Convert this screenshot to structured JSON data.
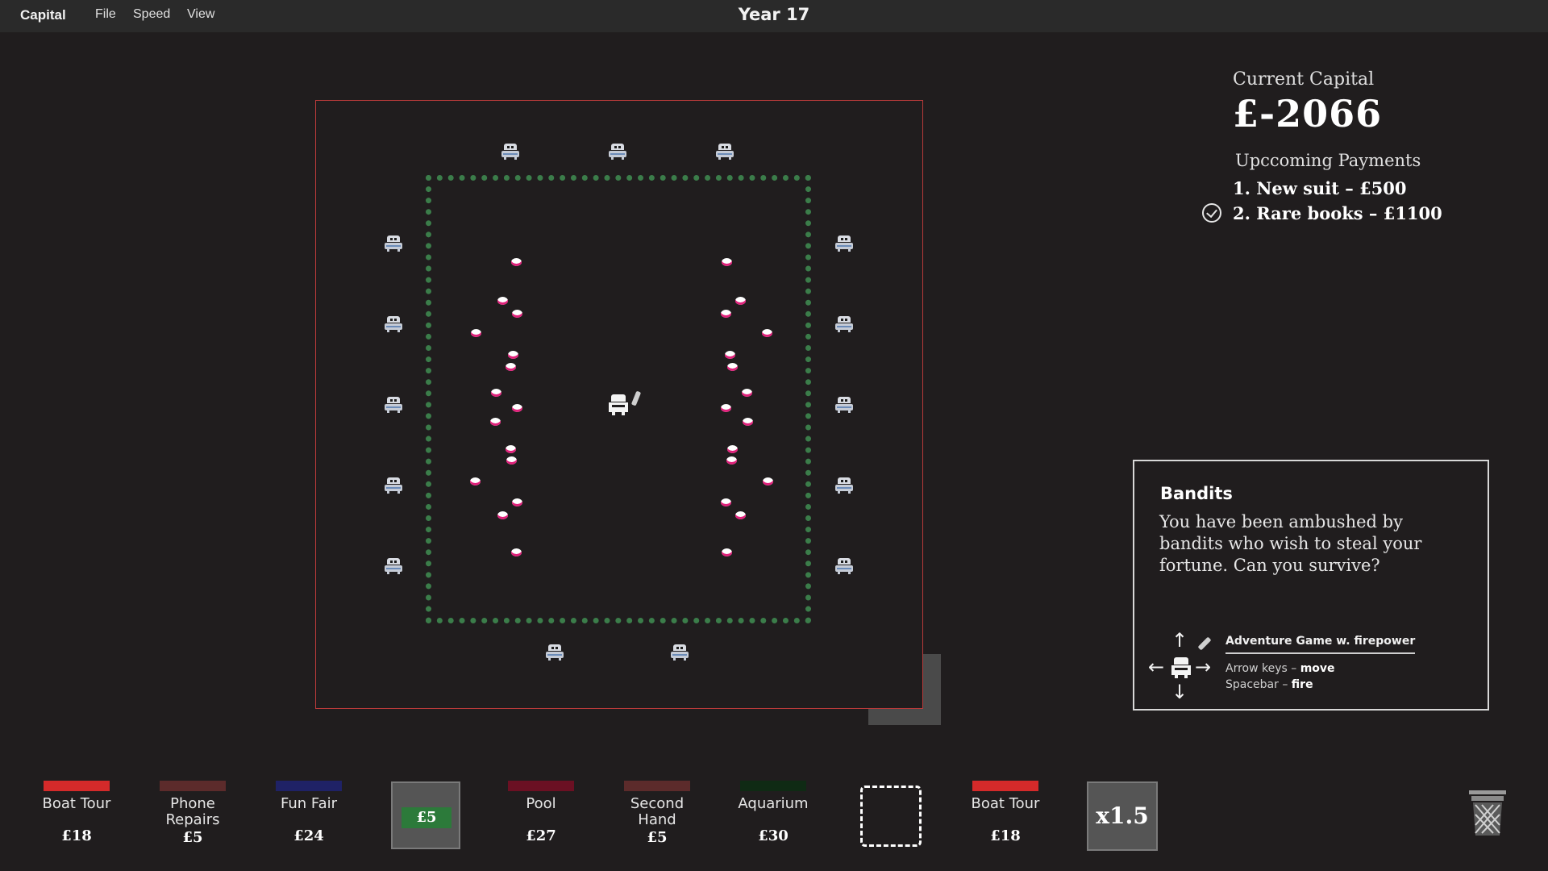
{
  "menubar": {
    "app_name": "Capital",
    "items": [
      "File",
      "Speed",
      "View"
    ],
    "year": "Year 17"
  },
  "capital": {
    "label": "Current Capital",
    "value": "£-2066"
  },
  "payments": {
    "title": "Upccoming Payments",
    "items": [
      "1. New suit – £500",
      "2. Rare books – £1100"
    ]
  },
  "event": {
    "title": "Bandits",
    "text": "You have been ambushed by bandits who wish to steal your fortune. Can you survive?",
    "game_label": "Adventure Game w. firepower",
    "controls": [
      {
        "key": "Arrow keys",
        "action": "move"
      },
      {
        "key": "Spacebar",
        "action": "fire"
      }
    ]
  },
  "cards": [
    {
      "name": "Boat Tour",
      "price": "£18",
      "color": "#d42a2a"
    },
    {
      "name": "Phone Repairs",
      "price": "£5",
      "color": "#5c2b2b"
    },
    {
      "name": "Fun Fair",
      "price": "£24",
      "color": "#1f2266"
    },
    {
      "name": "Pool",
      "price": "£27",
      "color": "#6b1023"
    },
    {
      "name": "Second Hand",
      "price": "£5",
      "color": "#5c2b2b"
    },
    {
      "name": "Aquarium",
      "price": "£30",
      "color": "#0f2a14"
    },
    {
      "name": "Boat Tour",
      "price": "£18",
      "color": "#d42a2a"
    }
  ],
  "slots": {
    "money": "£5",
    "multiplier": "x1.5"
  },
  "colors": {
    "background": "#201d1e",
    "field_border": "#b93a3a",
    "fence": "#3b7d4a",
    "petal_accent": "#e0207a"
  },
  "icons": [
    "bandit-icon",
    "player-icon",
    "gun-icon",
    "flower-petal-icon",
    "checkmark-icon",
    "arrow-icon",
    "trash-icon"
  ]
}
